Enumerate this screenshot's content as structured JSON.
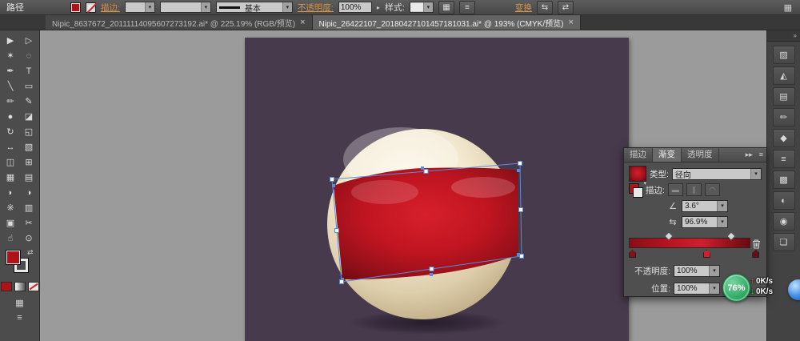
{
  "colors": {
    "accent_red": "#b01218",
    "artboard_purple": "#483a4d",
    "ball_cream": "#f3e9d0",
    "band_red": "#c01521",
    "selection_blue": "#5b8bd8",
    "badge_green": "#2aa45e",
    "link_orange": "#d1954e"
  },
  "icons": {
    "dropdown": "▾",
    "expand": "»",
    "double_arrow": "▸▸",
    "menu": "≡",
    "grid": "▦",
    "angle": "∠",
    "aspect": "⇆",
    "swap": "⇄",
    "up": "↑",
    "down": "↓",
    "right_small": "▸"
  },
  "top_bar": {
    "object_label": "路径",
    "stroke_link": "描边:",
    "brush_label": "基本",
    "opacity_link": "不透明度:",
    "opacity_value": "100%",
    "style_label": "样式:",
    "transform_link": "变换"
  },
  "tabs": [
    {
      "label": "Nipic_8637672_20111114095607273192.ai* @ 225.19% (RGB/预览)",
      "close_label": "×",
      "active": false
    },
    {
      "label": "Nipic_26422107_20180427101457181031.ai* @ 193% (CMYK/预览)",
      "close_label": "×",
      "active": true
    }
  ],
  "toolbar": {
    "tools": [
      {
        "name": "selection-tool",
        "glyph": "▶"
      },
      {
        "name": "direct-selection-tool",
        "glyph": "▷"
      },
      {
        "name": "magic-wand-tool",
        "glyph": "✶"
      },
      {
        "name": "lasso-tool",
        "glyph": "◌"
      },
      {
        "name": "pen-tool",
        "glyph": "✒"
      },
      {
        "name": "type-tool",
        "glyph": "T"
      },
      {
        "name": "line-segment-tool",
        "glyph": "╲"
      },
      {
        "name": "rectangle-tool",
        "glyph": "▭"
      },
      {
        "name": "paintbrush-tool",
        "glyph": "✏"
      },
      {
        "name": "pencil-tool",
        "glyph": "✎"
      },
      {
        "name": "blob-brush-tool",
        "glyph": "●"
      },
      {
        "name": "eraser-tool",
        "glyph": "◪"
      },
      {
        "name": "rotate-tool",
        "glyph": "↻"
      },
      {
        "name": "scale-tool",
        "glyph": "◱"
      },
      {
        "name": "width-tool",
        "glyph": "↔"
      },
      {
        "name": "free-transform-tool",
        "glyph": "▧"
      },
      {
        "name": "shape-builder-tool",
        "glyph": "◫"
      },
      {
        "name": "perspective-grid-tool",
        "glyph": "⊞"
      },
      {
        "name": "mesh-tool",
        "glyph": "▦"
      },
      {
        "name": "gradient-tool",
        "glyph": "▤"
      },
      {
        "name": "eyedropper-tool",
        "glyph": "◗"
      },
      {
        "name": "blend-tool",
        "glyph": "◑"
      },
      {
        "name": "symbol-sprayer-tool",
        "glyph": "※"
      },
      {
        "name": "column-graph-tool",
        "glyph": "▥"
      },
      {
        "name": "artboard-tool",
        "glyph": "▣"
      },
      {
        "name": "slice-tool",
        "glyph": "✂"
      },
      {
        "name": "hand-tool",
        "glyph": "☝"
      },
      {
        "name": "zoom-tool",
        "glyph": "⊙"
      }
    ]
  },
  "dock": {
    "icons": [
      {
        "name": "color-panel-icon",
        "glyph": "▨"
      },
      {
        "name": "color-guide-panel-icon",
        "glyph": "◭"
      },
      {
        "name": "swatches-panel-icon",
        "glyph": "▤"
      },
      {
        "name": "brushes-panel-icon",
        "glyph": "✏"
      },
      {
        "name": "symbols-panel-icon",
        "glyph": "◆"
      },
      {
        "name": "stroke-panel-icon",
        "glyph": "≡"
      },
      {
        "name": "gradient-panel-icon",
        "glyph": "▩"
      },
      {
        "name": "transparency-panel-icon",
        "glyph": "◐"
      },
      {
        "name": "appearance-panel-icon",
        "glyph": "◉"
      },
      {
        "name": "layers-panel-icon",
        "glyph": "❏"
      }
    ]
  },
  "panel": {
    "tabs": [
      {
        "label": "描边",
        "active": false
      },
      {
        "label": "渐变",
        "active": true
      },
      {
        "label": "透明度",
        "active": false
      }
    ],
    "type_label": "类型:",
    "type_value": "径向",
    "stroke_label": "描边:",
    "angle_value": "3.6°",
    "aspect_value": "96.9%",
    "opacity_label": "不透明度:",
    "opacity_value": "100%",
    "location_label": "位置:",
    "location_value": "100%",
    "gradient": {
      "stops": [
        {
          "pos": 0,
          "color": "#8a0e18"
        },
        {
          "pos": 30,
          "color": "#b31320"
        },
        {
          "pos": 60,
          "color": "#d01f2e"
        },
        {
          "pos": 85,
          "color": "#8e101b"
        },
        {
          "pos": 100,
          "color": "#6a0a12"
        }
      ],
      "markers": [
        {
          "pos": 0,
          "color": "#8a0e18"
        },
        {
          "pos": 60,
          "color": "#d01f2e"
        },
        {
          "pos": 100,
          "color": "#6a0a12"
        }
      ],
      "midpoints": [
        30,
        80
      ]
    }
  },
  "overlays": {
    "progress_badge": "76%",
    "upload_speed": "0K/s",
    "download_speed": "0K/s"
  }
}
